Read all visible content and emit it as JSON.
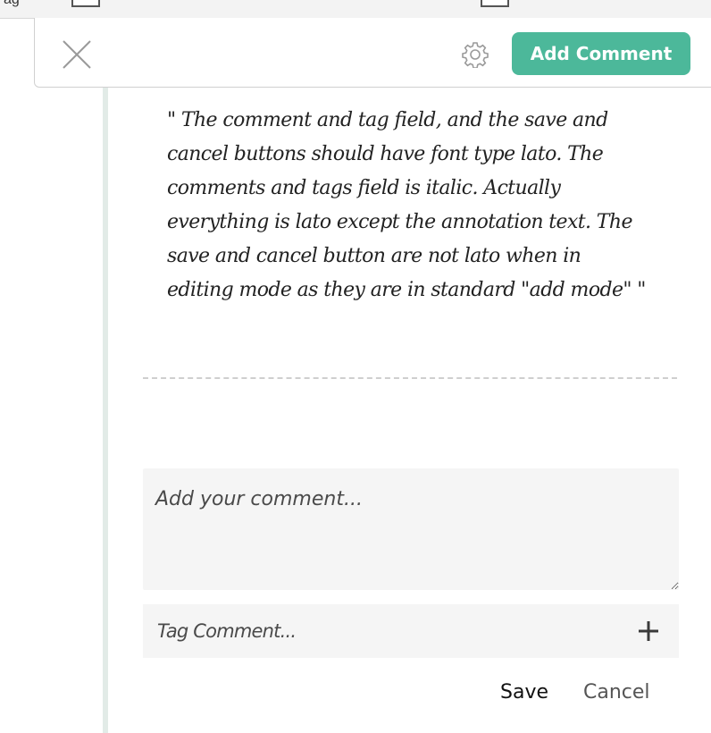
{
  "top_strip": {
    "left_fragment": "ag",
    "right_fragment": ""
  },
  "header": {
    "close_icon": "close-icon",
    "settings_icon": "gear-icon",
    "add_comment_label": "Add Comment",
    "accent_color": "#4cb89a"
  },
  "annotation": {
    "text": "\" The comment and tag field, and the save and cancel buttons should have font type lato. The comments and tags field is italic. Actually everything is lato except the annotation text. The save and cancel button are not lato when in editing mode as they are in standard \"add mode\" \""
  },
  "comment_form": {
    "comment_placeholder": "Add your comment...",
    "tag_placeholder": "Tag Comment...",
    "tag_add_icon": "plus-icon",
    "save_label": "Save",
    "cancel_label": "Cancel"
  }
}
